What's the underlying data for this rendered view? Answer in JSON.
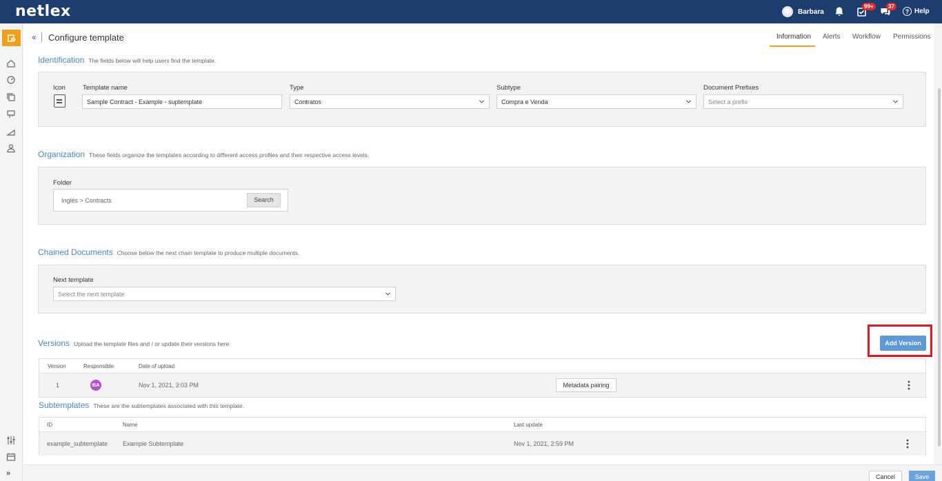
{
  "app": {
    "logo": "netlex"
  },
  "topbar": {
    "user_name": "Barbara",
    "tasks_badge": "99+",
    "messages_badge": "37",
    "help_label": "Help"
  },
  "header": {
    "collapse_glyph": "«",
    "title": "Configure template",
    "tabs": [
      {
        "label": "Information",
        "active": true
      },
      {
        "label": "Alerts"
      },
      {
        "label": "Workflow"
      },
      {
        "label": "Permissions"
      }
    ]
  },
  "identification": {
    "title": "Identification",
    "description": "The fields below will help users find the template.",
    "icon_label": "Icon",
    "template_name_label": "Template name",
    "template_name_value": "Sample Contract - Example - suptemplate",
    "type_label": "Type",
    "type_value": "Contratos",
    "subtype_label": "Subtype",
    "subtype_value": "Compra e Venda",
    "prefix_label": "Document Prefixes",
    "prefix_placeholder": "Select a prefix"
  },
  "organization": {
    "title": "Organization",
    "description": "These fields organize the templates according to different access profiles and their respective access levels.",
    "folder_label": "Folder",
    "folder_path": "Inglés  >  Contracts",
    "search_button": "Search"
  },
  "chained": {
    "title": "Chained Documents",
    "description": "Choose below the next chain template to produce multiple documents.",
    "next_label": "Next template",
    "next_placeholder": "Select the next template"
  },
  "versions": {
    "title": "Versions",
    "description": "Upload the template files and / or update their versions here",
    "add_button": "Add Version",
    "columns": [
      "Version",
      "Responsible",
      "Date of upload"
    ],
    "rows": [
      {
        "version": "1",
        "responsible_initials": "BA",
        "date": "Nov 1, 2021, 3:03 PM",
        "action": "Metadata pairing"
      }
    ]
  },
  "subtemplates": {
    "title": "Subtemplates",
    "description": "These are the subtemplates associated with this template.",
    "columns": [
      "ID",
      "Name",
      "Last update"
    ],
    "rows": [
      {
        "id": "example_subtemplate",
        "name": "Example Subtemplate",
        "updated": "Nov 1, 2021, 2:59 PM"
      }
    ]
  },
  "footer": {
    "cancel_label": "Cancel",
    "save_label": "Save",
    "expand_glyph": "»"
  },
  "colors": {
    "topbar": "#1d3d6f",
    "accent": "#f0a11b",
    "link_blue": "#4a86c5",
    "primary_button": "#5c99d6",
    "highlight_red": "#e3151f",
    "avatar_purple": "#b552c9",
    "badge_red": "#e02b2b"
  }
}
